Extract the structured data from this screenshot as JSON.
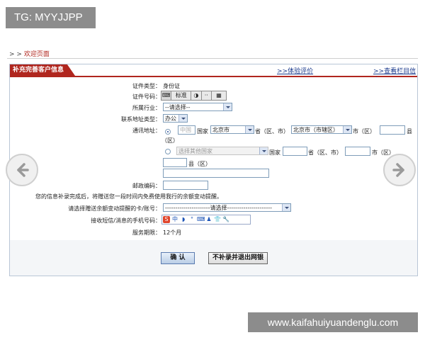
{
  "overlay_tag": "TG: MYYJJPP",
  "breadcrumb": {
    "arrows": "> >",
    "link": "欢迎页面"
  },
  "panel": {
    "title": "补充完善客户信息",
    "link_rating": ">>体验评价",
    "link_column": ">>查看栏目信息"
  },
  "form": {
    "id_type_label": "证件类型：",
    "id_type_value": "身份证",
    "id_number_label": "证件号码：",
    "keyboard_toolbar": [
      "标准",
      "◑",
      "··",
      "▦"
    ],
    "industry_label": "所属行业：",
    "industry_value": "--请选择--",
    "address_type_label": "联系地址类型：",
    "address_type_value": "办公",
    "address_label": "通讯地址：",
    "china_option": {
      "country_value": "中国",
      "country_suffix": "国家",
      "province_value": "北京市",
      "province_suffix": "省（区、市）",
      "city_value": "北京市（市辖区）",
      "city_suffix": "市（区）",
      "county_suffix": "县",
      "county_suffix_2": "（区）"
    },
    "other_option": {
      "country_value": "选择其他国家",
      "country_suffix": "国家",
      "province_suffix": "省（区、市）",
      "city_suffix": "市（区）",
      "county_suffix": "县（区）"
    },
    "postcode_label": "邮政编码：",
    "notice": "您的信息补录完成后，将赠送您一段时间内免费使用我行的余额变动提醒。",
    "card_label": "请选择赠送余额变动提醒的卡/账号：",
    "card_value": "----------------------请选择----------------------",
    "mobile_label": "接收短信/消息的手机号码：",
    "ime_icons": [
      "S",
      "中",
      "◗",
      "°",
      "⌨",
      "♟",
      "👕",
      "🔧"
    ],
    "service_label": "服务期限：",
    "service_value": "12个月"
  },
  "buttons": {
    "confirm": "确 认",
    "skip": "不补录并退出网银"
  },
  "watermark": "www.kaifahuiyuandenglu.com",
  "colors": {
    "brand_red": "#b0261e",
    "link_blue": "#1a3a8c"
  }
}
